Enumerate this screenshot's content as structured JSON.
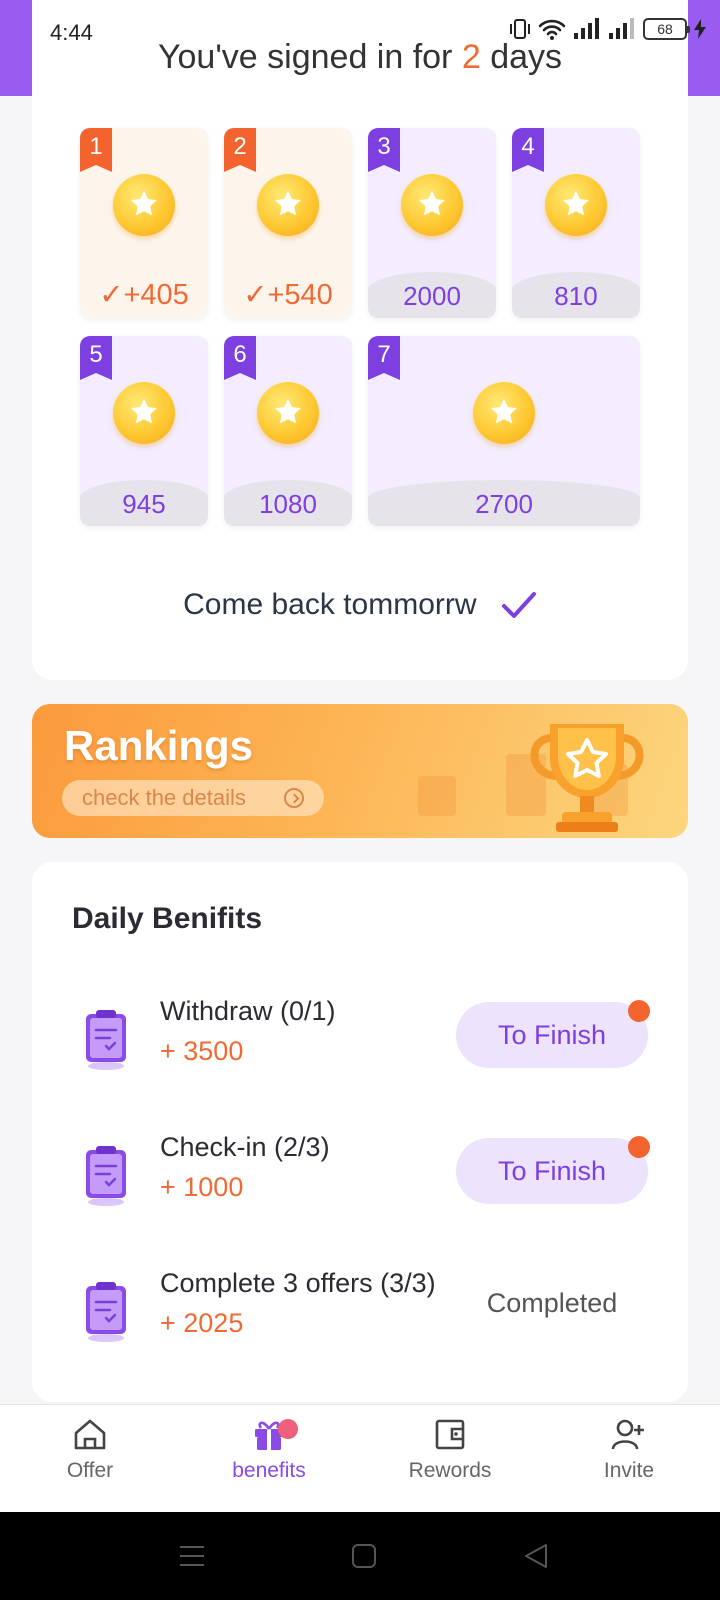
{
  "status_bar": {
    "time": "4:44",
    "battery": "68"
  },
  "signin": {
    "prefix": "You've signed in for",
    "days": "2",
    "suffix": "days",
    "come_back": "Come back tommorrw"
  },
  "days": [
    {
      "day": "1",
      "state": "done",
      "label": "✓+405"
    },
    {
      "day": "2",
      "state": "done",
      "label": "✓+540"
    },
    {
      "day": "3",
      "state": "future",
      "amount": "2000",
      "unit": "coins"
    },
    {
      "day": "4",
      "state": "future",
      "amount": "810",
      "unit": "coins"
    },
    {
      "day": "5",
      "state": "future",
      "amount": "945",
      "unit": "coins"
    },
    {
      "day": "6",
      "state": "future",
      "amount": "1080",
      "unit": "coins"
    },
    {
      "day": "7",
      "state": "future",
      "amount": "2700",
      "unit": "coins"
    }
  ],
  "rankings": {
    "title": "Rankings",
    "link": "check the details"
  },
  "daily_benefits": {
    "title": "Daily Benifits",
    "tasks": [
      {
        "name": "Withdraw (0/1)",
        "reward": "+ 3500",
        "action": "To Finish",
        "badge": true
      },
      {
        "name": "Check-in (2/3)",
        "reward": "+ 1000",
        "action": "To Finish",
        "badge": true
      },
      {
        "name": "Complete 3 offers (3/3)",
        "reward": "+ 2025",
        "action": "Completed",
        "badge": false
      }
    ]
  },
  "bottom_nav": {
    "items": [
      {
        "label": "Offer",
        "icon": "home-icon"
      },
      {
        "label": "benefits",
        "icon": "gift-icon",
        "active": true,
        "badge": true
      },
      {
        "label": "Rewords",
        "icon": "wallet-icon"
      },
      {
        "label": "Invite",
        "icon": "add-user-icon"
      }
    ]
  },
  "colors": {
    "accent": "#7e3fe0",
    "orange": "#f06a35",
    "header": "#9a5bf0"
  }
}
